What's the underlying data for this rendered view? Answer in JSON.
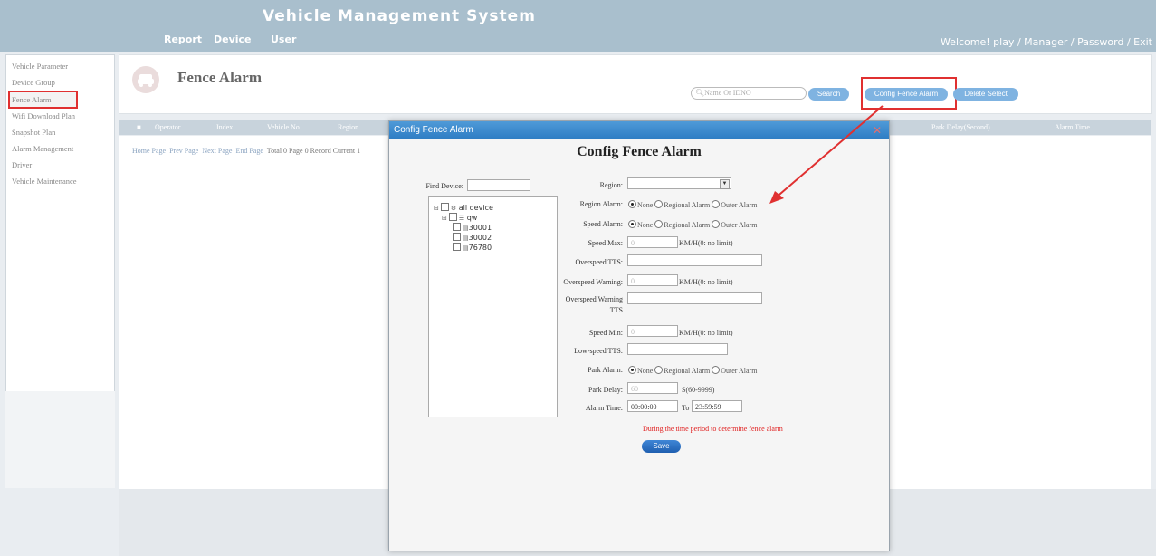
{
  "header": {
    "title": "Vehicle Management System",
    "nav": [
      "Report",
      "Device",
      "User"
    ],
    "user_links": "Welcome! play / Manager / Password / Exit"
  },
  "sidebar": {
    "items": [
      {
        "label": "Vehicle Parameter"
      },
      {
        "label": "Device Group"
      },
      {
        "label": "Fence Alarm"
      },
      {
        "label": "Wifi Download Plan"
      },
      {
        "label": "Snapshot Plan"
      },
      {
        "label": "Alarm Management"
      },
      {
        "label": "Driver"
      },
      {
        "label": "Vehicle Maintenance"
      }
    ]
  },
  "page": {
    "title": "Fence Alarm",
    "search_placeholder": "Name Or IDNO",
    "search_button": "Search",
    "config_button": "Config Fence Alarm",
    "delete_button": "Delete Select"
  },
  "table": {
    "columns": [
      "Operator",
      "Index",
      "Vehicle No",
      "Region",
      "Park Delay(Second)",
      "Alarm Time"
    ]
  },
  "pagination": {
    "links": [
      "Home Page",
      "Prev Page",
      "Next Page",
      "End Page"
    ],
    "info": "Total 0 Page  0 Record  Current  1"
  },
  "modal": {
    "bar_title": "Config Fence Alarm",
    "close": "✕",
    "heading": "Config Fence Alarm",
    "find_device_label": "Find Device:",
    "tree": {
      "root": "all device",
      "group": "qw",
      "devices": [
        "30001",
        "30002",
        "76780"
      ]
    },
    "form": {
      "region_label": "Region:",
      "region_alarm_label": "Region Alarm:",
      "speed_alarm_label": "Speed Alarm:",
      "speed_max_label": "Speed Max:",
      "speed_max_value": "0",
      "kmh_hint": "KM/H(0: no limit)",
      "overspeed_tts_label": "Overspeed TTS:",
      "overspeed_warning_label": "Overspeed Warning:",
      "overspeed_warning_value": "0",
      "overspeed_warning_tts_label": "Overspeed Warning",
      "overspeed_warning_tts_label2": "TTS",
      "speed_min_label": "Speed Min:",
      "speed_min_value": "0",
      "lowspeed_tts_label": "Low-speed TTS:",
      "park_alarm_label": "Park Alarm:",
      "park_delay_label": "Park Delay:",
      "park_delay_value": "60",
      "park_delay_hint": "S(60-9999)",
      "alarm_time_label": "Alarm Time:",
      "alarm_time_from": "00:00:00",
      "alarm_time_to_label": "To",
      "alarm_time_to": "23:59:59",
      "radio_options": [
        "None",
        "Regional Alarm",
        "Outer Alarm"
      ],
      "warning": "During the time period to determine fence alarm",
      "save": "Save"
    }
  },
  "colors": {
    "header_bg": "#a9bfcd",
    "accent_blue": "#2d7cc3",
    "highlight_red": "#e03030"
  }
}
